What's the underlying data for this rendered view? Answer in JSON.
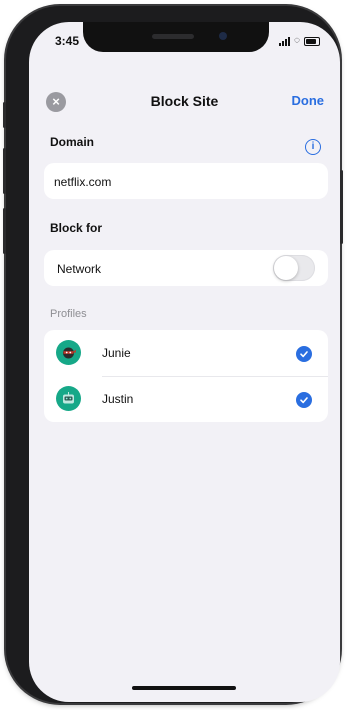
{
  "status_bar": {
    "time": "3:45"
  },
  "nav": {
    "title": "Block Site",
    "done_label": "Done",
    "close_glyph": "×"
  },
  "domain": {
    "section_label": "Domain",
    "info_glyph": "i",
    "value": "netflix.com"
  },
  "block_for": {
    "section_label": "Block for",
    "network_label": "Network",
    "network_enabled": false
  },
  "profiles": {
    "section_label": "Profiles",
    "items": [
      {
        "name": "Junie",
        "checked": true,
        "avatar_icon": "ninja-avatar-icon"
      },
      {
        "name": "Justin",
        "checked": true,
        "avatar_icon": "robot-avatar-icon"
      }
    ]
  },
  "colors": {
    "accent": "#2a6ee0",
    "avatar_bg": "#16a888",
    "screen_bg": "#f2f1f6"
  }
}
